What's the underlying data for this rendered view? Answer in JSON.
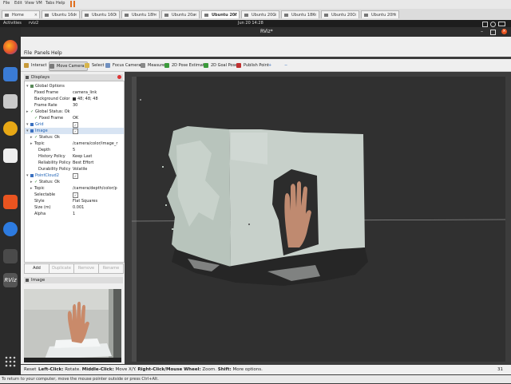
{
  "vm": {
    "menu": [
      "File",
      "Edit",
      "View",
      "VM",
      "Tabs",
      "Help"
    ],
    "tabs": [
      "Home",
      "Ubuntu 16d",
      "Ubuntu 16O",
      "Ubuntu 18h",
      "Ubuntu 20a",
      "Ubuntu 20f",
      "Ubuntu 20G",
      "Ubuntu 18K",
      "Ubuntu 20C",
      "Ubuntu 20H"
    ],
    "active_tab_index": 5
  },
  "topbar": {
    "activities": "Activities",
    "app_name": "rviz2",
    "clock": "Jun 20  14:28"
  },
  "window": {
    "title": "RViz*"
  },
  "menubar": [
    "File",
    "Panels",
    "Help"
  ],
  "toolbar": {
    "tools": [
      "Interact",
      "Move Camera",
      "Select",
      "Focus Camera",
      "Measure",
      "2D Pose Estimate",
      "2D Goal Pose",
      "Publish Point"
    ],
    "active_index": 1,
    "add": "+",
    "remove": "−"
  },
  "displays_panel": {
    "title": "Displays",
    "rows": [
      {
        "label": "Global Options",
        "value": "",
        "indent": 1,
        "kind": "section"
      },
      {
        "label": "Fixed Frame",
        "value": "camera_link",
        "indent": 2
      },
      {
        "label": "Background Color",
        "value": "48; 48; 48",
        "indent": 2,
        "swatch": true
      },
      {
        "label": "Frame Rate",
        "value": "30",
        "indent": 2
      },
      {
        "label": "Global Status: Ok",
        "value": "",
        "indent": 1,
        "check": true
      },
      {
        "label": "Fixed Frame",
        "value": "OK",
        "indent": 2,
        "check": true
      },
      {
        "label": "Grid",
        "value": "",
        "indent": 1,
        "display": true,
        "checkbox": true
      },
      {
        "label": "Image",
        "value": "",
        "indent": 1,
        "display": true,
        "checkbox": true
      },
      {
        "label": "Status: Ok",
        "value": "",
        "indent": 2,
        "check": true
      },
      {
        "label": "Topic",
        "value": "/camera/color/image_r",
        "indent": 2
      },
      {
        "label": "Depth",
        "value": "5",
        "indent": 3
      },
      {
        "label": "History Policy",
        "value": "Keep Last",
        "indent": 3
      },
      {
        "label": "Reliability Policy",
        "value": "Best Effort",
        "indent": 3
      },
      {
        "label": "Durability Policy",
        "value": "Volatile",
        "indent": 3
      },
      {
        "label": "PointCloud2",
        "value": "",
        "indent": 1,
        "display": true,
        "checkbox": true
      },
      {
        "label": "Status: Ok",
        "value": "",
        "indent": 2,
        "check": true
      },
      {
        "label": "Topic",
        "value": "/camera/depth/color/p",
        "indent": 2
      },
      {
        "label": "Selectable",
        "value": "",
        "indent": 2,
        "checkbox": true
      },
      {
        "label": "Style",
        "value": "Flat Squares",
        "indent": 2
      },
      {
        "label": "Size (m)",
        "value": "0.001",
        "indent": 2
      },
      {
        "label": "Alpha",
        "value": "1",
        "indent": 2
      }
    ],
    "buttons": [
      {
        "label": "Add",
        "disabled": false
      },
      {
        "label": "Duplicate",
        "disabled": true
      },
      {
        "label": "Remove",
        "disabled": true
      },
      {
        "label": "Rename",
        "disabled": true
      }
    ]
  },
  "image_panel": {
    "title": "Image"
  },
  "statusbar": {
    "reset": "Reset",
    "hint_parts": [
      {
        "text": "Left-Click:",
        "bold": true
      },
      {
        "text": " Rotate.  ",
        "bold": false
      },
      {
        "text": "Middle-Click:",
        "bold": true
      },
      {
        "text": " Move X/Y.  ",
        "bold": false
      },
      {
        "text": "Right-Click/Mouse Wheel:",
        "bold": true
      },
      {
        "text": " Zoom.  ",
        "bold": false
      },
      {
        "text": "Shift:",
        "bold": true
      },
      {
        "text": " More options.",
        "bold": false
      }
    ],
    "fps": "31 fps"
  },
  "host_message": "To return to your computer, move the mouse pointer outside or press Ctrl+Alt.",
  "colors": {
    "viewport_bg": "#303030",
    "accent": "#1a5fb4",
    "ok": "#2a8a2a"
  }
}
